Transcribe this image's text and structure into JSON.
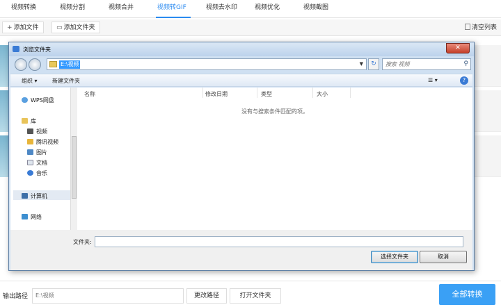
{
  "tabs": [
    {
      "label": "视频转换"
    },
    {
      "label": "视频分割"
    },
    {
      "label": "视频合并"
    },
    {
      "label": "视频转GIF",
      "active": true
    },
    {
      "label": "视频去水印"
    },
    {
      "label": "视频优化"
    },
    {
      "label": "视频截图"
    }
  ],
  "toolbar": {
    "add_file": "添加文件",
    "add_folder": "添加文件夹",
    "clear_list": "清空列表"
  },
  "bottom": {
    "output_label": "输出路径",
    "output_path": "E:\\视频",
    "change_path": "更改路径",
    "open_folder": "打开文件夹",
    "convert_all": "全部转换"
  },
  "dialog": {
    "title": "浏览文件夹",
    "address": "E:\\视频",
    "search_placeholder": "搜索 视频",
    "organize": "组织 ▾",
    "new_folder": "新建文件夹",
    "close": "✕",
    "nav": {
      "wps": "WPS网盘",
      "library": "库",
      "videos": "视频",
      "tencent_video": "腾讯视频",
      "pictures": "图片",
      "documents": "文档",
      "music": "音乐",
      "computer": "计算机",
      "network": "网络"
    },
    "columns": {
      "name": "名称",
      "modified": "修改日期",
      "type": "类型",
      "size": "大小"
    },
    "empty_text": "没有与搜索条件匹配的项。",
    "folder_label": "文件夹:",
    "select_button": "选择文件夹",
    "cancel_button": "取消"
  },
  "colors": {
    "accent": "#2a8af0",
    "convert": "#3aa0f5"
  }
}
